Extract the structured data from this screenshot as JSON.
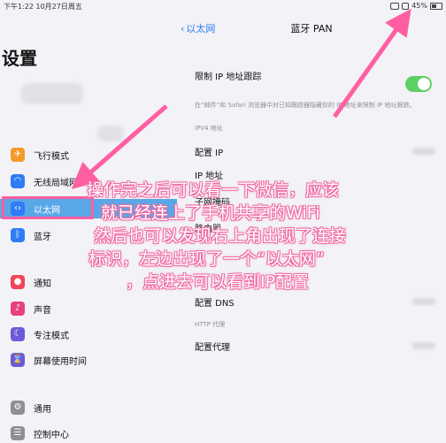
{
  "status_bar": {
    "time": "下午1:22  10月27日周五",
    "battery": "45%"
  },
  "settings": {
    "title": "设置"
  },
  "sidebar": {
    "items": [
      {
        "label": "飞行模式",
        "icon": "airplane-icon",
        "color": "#f39a2b"
      },
      {
        "label": "无线局域网",
        "icon": "wifi-icon",
        "color": "#2f7cf6"
      },
      {
        "label": "以太网",
        "icon": "ethernet-icon",
        "color": "#2f7cf6",
        "selected": true
      },
      {
        "label": "蓝牙",
        "icon": "bluetooth-icon",
        "color": "#2f7cf6"
      },
      {
        "label": "通知",
        "icon": "notification-icon",
        "color": "#f1455c"
      },
      {
        "label": "声音",
        "icon": "sound-icon",
        "color": "#e8417b"
      },
      {
        "label": "专注模式",
        "icon": "focus-icon",
        "color": "#6b5bd9"
      },
      {
        "label": "屏幕使用时间",
        "icon": "hourglass-icon",
        "color": "#6b5bd9"
      },
      {
        "label": "通用",
        "icon": "gear-icon",
        "color": "#8e8e93"
      },
      {
        "label": "控制中心",
        "icon": "control-center-icon",
        "color": "#8e8e93"
      }
    ]
  },
  "detail": {
    "back_label": "以太网",
    "title": "蓝牙 PAN",
    "limit_ip_label": "限制 IP 地址跟踪",
    "limit_ip_desc": "在“邮件”和 Safari 浏览器中对已知跟踪器隐藏你的 IP 地址来限制 IP 地址跟踪。",
    "ipv4_header": "IPV4 地址",
    "configure_ip": "配置 IP",
    "ip_address": "IP 地址",
    "subnet_mask": "子网掩码",
    "router": "路由器",
    "configure_dns": "配置 DNS",
    "http_proxy_header": "HTTP 代理",
    "configure_proxy": "配置代理"
  },
  "annotation": {
    "lines": [
      "操作完之后可以看一下微信，应该",
      "就已经连上了手机共享的WiFi",
      "然后也可以发现右上角出现了连接",
      "标识，左边出现了一个“以太网”",
      "，点进去可以看到IP配置"
    ]
  }
}
